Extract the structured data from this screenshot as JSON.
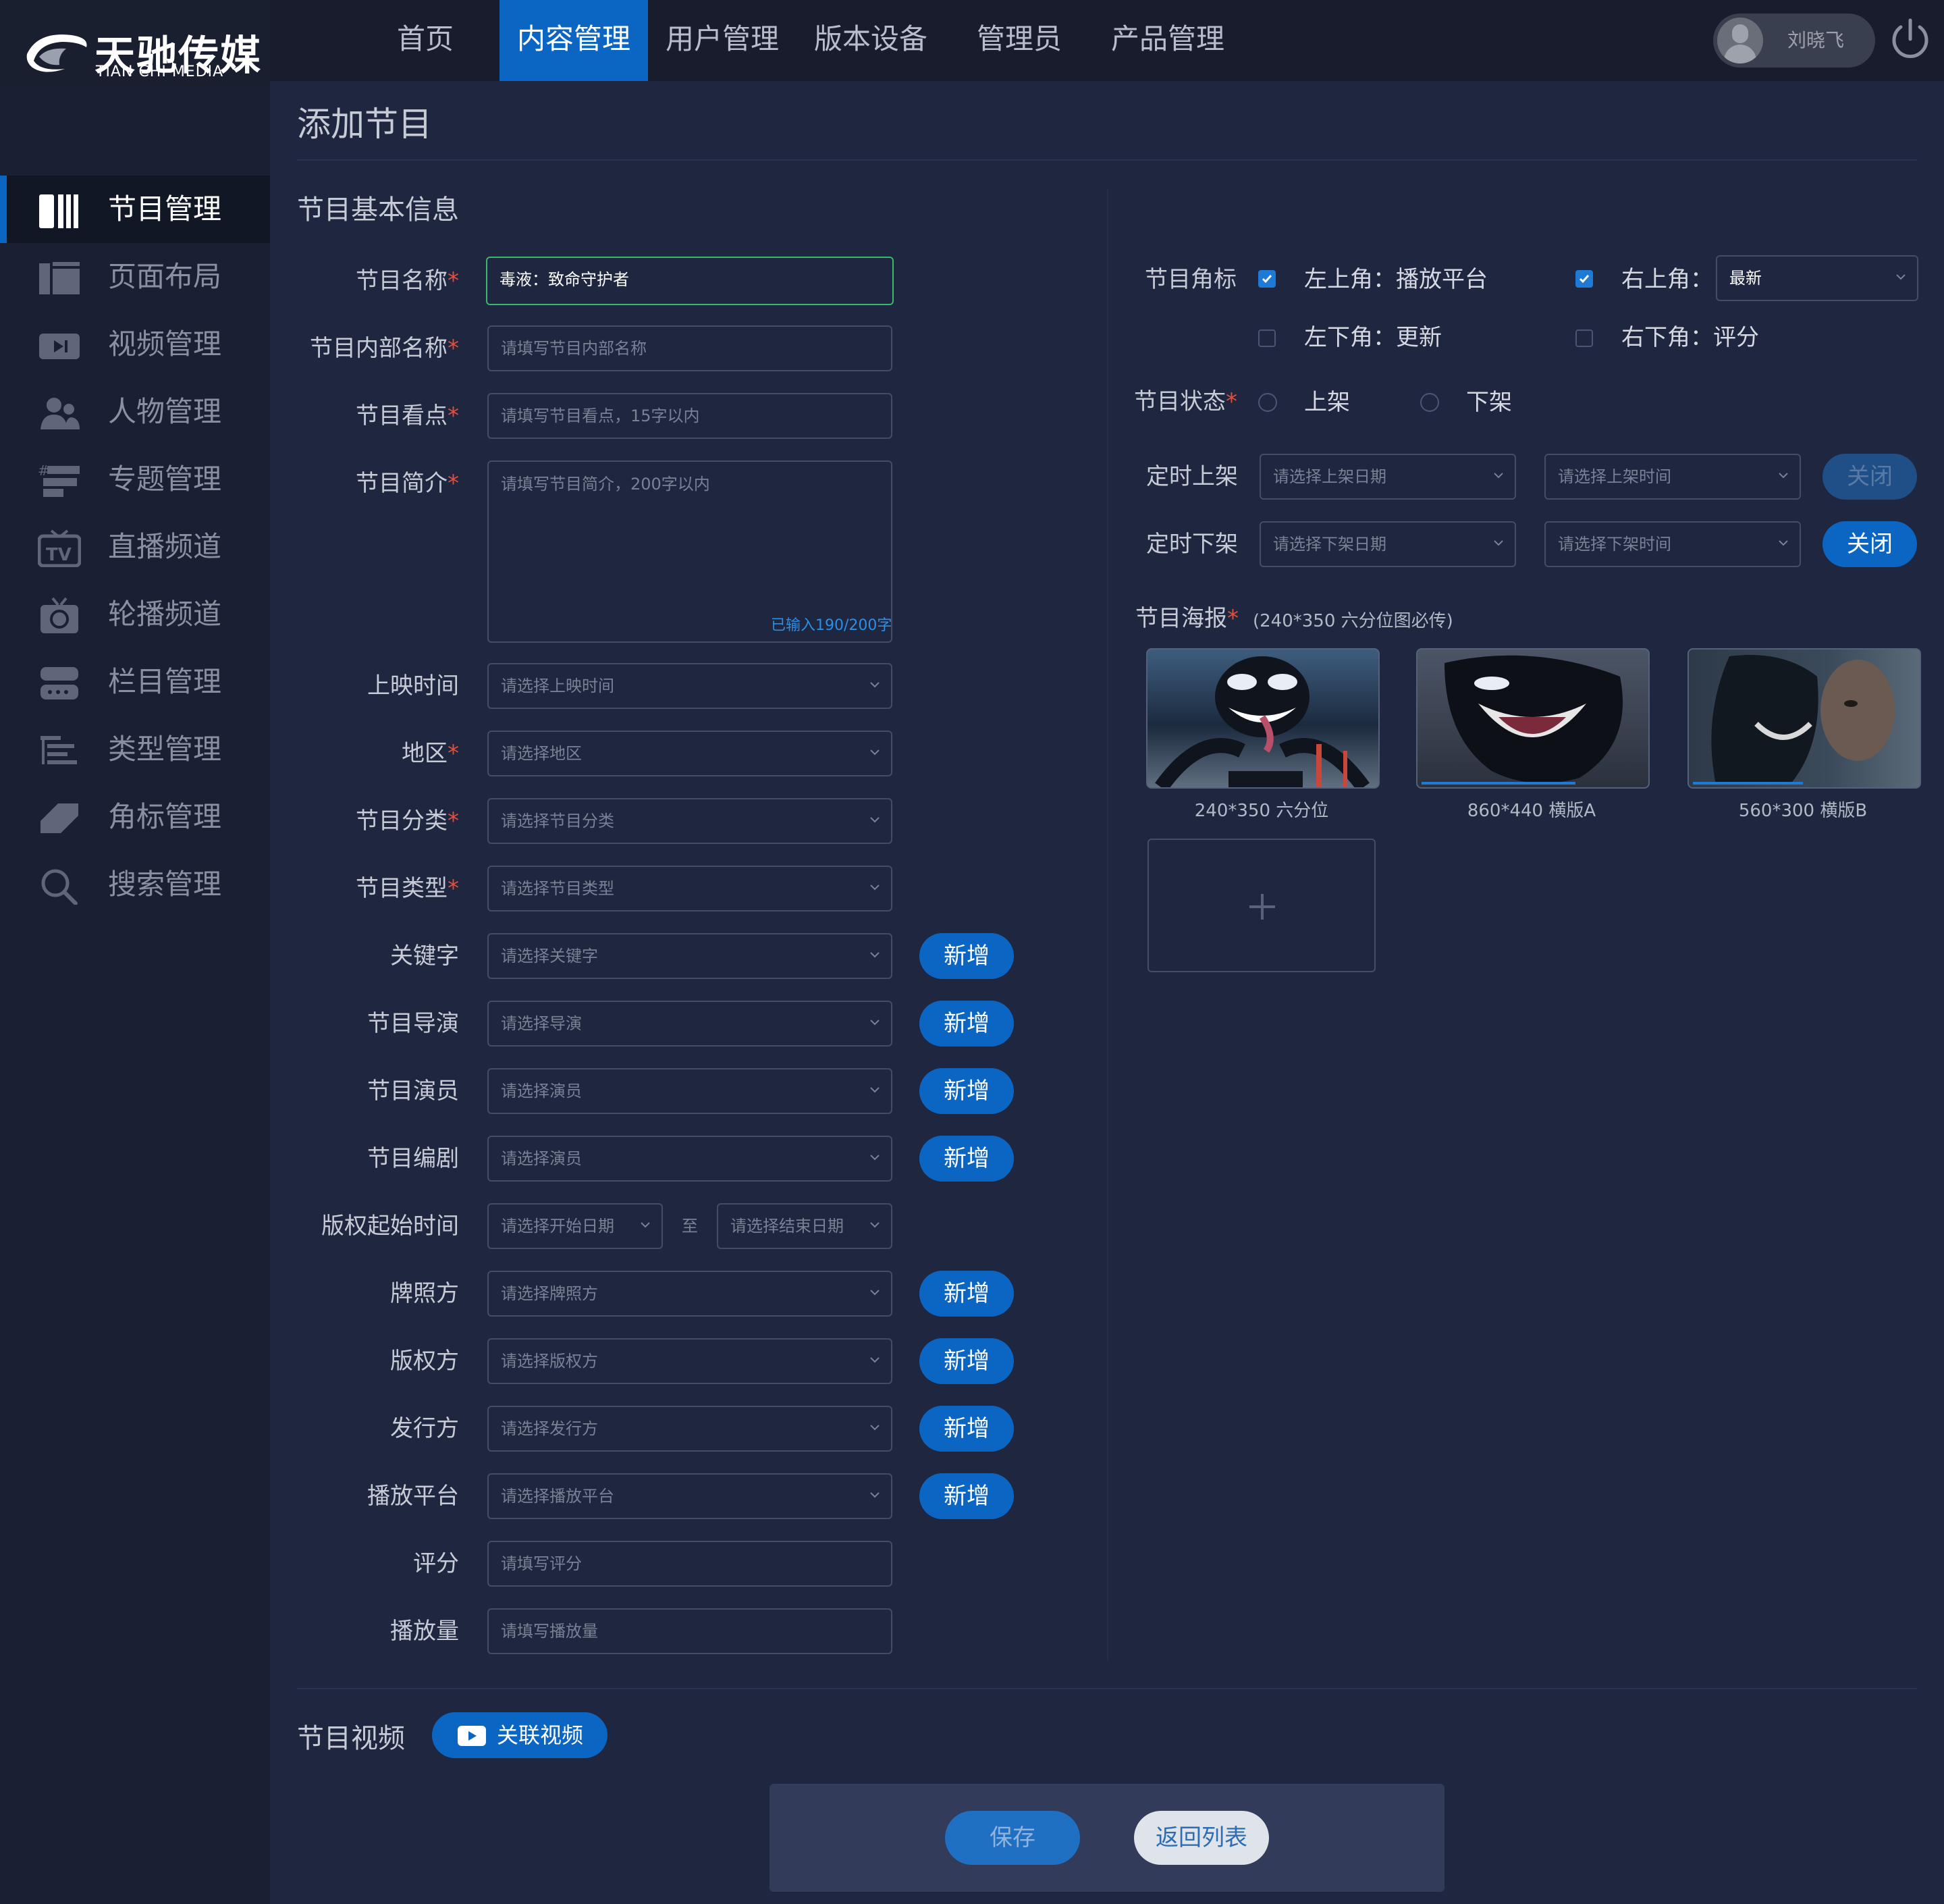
{
  "brand": {
    "name_cn": "天驰传媒",
    "name_en": "TIAN CHI MEDIA"
  },
  "topnav": [
    {
      "label": "首页",
      "active": false
    },
    {
      "label": "内容管理",
      "active": true
    },
    {
      "label": "用户管理",
      "active": false
    },
    {
      "label": "版本设备",
      "active": false
    },
    {
      "label": "管理员",
      "active": false
    },
    {
      "label": "产品管理",
      "active": false
    }
  ],
  "user": {
    "name": "刘晓飞"
  },
  "sidebar": [
    {
      "label": "节目管理",
      "icon": "program-icon",
      "active": true
    },
    {
      "label": "页面布局",
      "icon": "layout-icon"
    },
    {
      "label": "视频管理",
      "icon": "video-icon"
    },
    {
      "label": "人物管理",
      "icon": "people-icon"
    },
    {
      "label": "专题管理",
      "icon": "topic-icon"
    },
    {
      "label": "直播频道",
      "icon": "tv-icon"
    },
    {
      "label": "轮播频道",
      "icon": "carousel-icon"
    },
    {
      "label": "栏目管理",
      "icon": "column-icon"
    },
    {
      "label": "类型管理",
      "icon": "type-icon"
    },
    {
      "label": "角标管理",
      "icon": "corner-mark-icon"
    },
    {
      "label": "搜索管理",
      "icon": "search-icon"
    }
  ],
  "page": {
    "title": "添加节目",
    "section_basic": "节目基本信息",
    "section_video": "节目视频"
  },
  "form": {
    "name": {
      "label": "节目名称",
      "value": "毒液：致命守护者"
    },
    "internal_name": {
      "label": "节目内部名称",
      "placeholder": "请填写节目内部名称"
    },
    "highlight": {
      "label": "节目看点",
      "placeholder": "请填写节目看点，15字以内"
    },
    "intro": {
      "label": "节目简介",
      "placeholder": "请填写节目简介，200字以内",
      "counter": "已输入190/200字"
    },
    "release": {
      "label": "上映时间",
      "placeholder": "请选择上映时间"
    },
    "region": {
      "label": "地区",
      "placeholder": "请选择地区"
    },
    "category": {
      "label": "节目分类",
      "placeholder": "请选择节目分类"
    },
    "type": {
      "label": "节目类型",
      "placeholder": "请选择节目类型"
    },
    "keyword": {
      "label": "关键字",
      "placeholder": "请选择关键字"
    },
    "director": {
      "label": "节目导演",
      "placeholder": "请选择导演"
    },
    "actor": {
      "label": "节目演员",
      "placeholder": "请选择演员"
    },
    "writer": {
      "label": "节目编剧",
      "placeholder": "请选择演员"
    },
    "copyright_period": {
      "label": "版权起始时间",
      "start_placeholder": "请选择开始日期",
      "sep": "至",
      "end_placeholder": "请选择结束日期"
    },
    "license": {
      "label": "牌照方",
      "placeholder": "请选择牌照方"
    },
    "copyright": {
      "label": "版权方",
      "placeholder": "请选择版权方"
    },
    "publisher": {
      "label": "发行方",
      "placeholder": "请选择发行方"
    },
    "platform": {
      "label": "播放平台",
      "placeholder": "请选择播放平台"
    },
    "score": {
      "label": "评分",
      "placeholder": "请填写评分"
    },
    "plays": {
      "label": "播放量",
      "placeholder": "请填写播放量"
    },
    "add_label": "新增"
  },
  "corner": {
    "label": "节目角标",
    "top_left": {
      "label": "左上角：播放平台",
      "checked": true
    },
    "top_right": {
      "label": "右上角：",
      "checked": true,
      "value": "最新"
    },
    "bottom_left": {
      "label": "左下角：更新",
      "checked": false
    },
    "bottom_right": {
      "label": "右下角：评分",
      "checked": false
    }
  },
  "status": {
    "label": "节目状态",
    "on": "上架",
    "off": "下架"
  },
  "schedule": {
    "on_label": "定时上架",
    "on_date": "请选择上架日期",
    "on_time": "请选择上架时间",
    "on_btn": "关闭",
    "off_label": "定时下架",
    "off_date": "请选择下架日期",
    "off_time": "请选择下架时间",
    "off_btn": "关闭"
  },
  "poster": {
    "label": "节目海报",
    "hint": "(240*350 六分位图必传)",
    "items": [
      {
        "caption": "240*350 六分位",
        "progress": null
      },
      {
        "caption": "860*440 横版A",
        "progress": 0.7
      },
      {
        "caption": "560*300 横版B",
        "progress": 0.5
      }
    ]
  },
  "video": {
    "link_btn": "关联视频"
  },
  "actions": {
    "save": "保存",
    "back": "返回列表"
  },
  "colors": {
    "accent": "#0b66c3",
    "bg": "#1f2640",
    "required": "#e0503e"
  }
}
